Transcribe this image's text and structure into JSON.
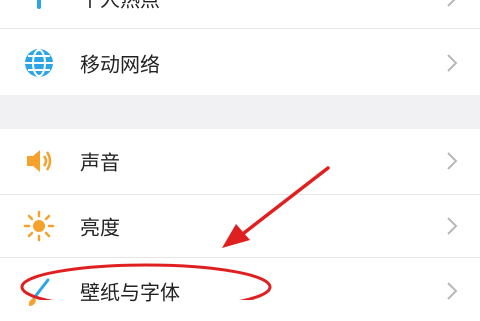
{
  "settings": {
    "items": [
      {
        "label": "个人热点",
        "icon": "hotspot-icon"
      },
      {
        "label": "移动网络",
        "icon": "globe-icon"
      },
      {
        "label": "声音",
        "icon": "speaker-icon"
      },
      {
        "label": "亮度",
        "icon": "sun-icon"
      },
      {
        "label": "壁纸与字体",
        "icon": "paintbrush-icon"
      }
    ]
  },
  "colors": {
    "accent": "#2aa5e6",
    "sound_brightness": "#f6a12c",
    "annotation": "#e02020",
    "section_gap": "#f1f1f3"
  }
}
